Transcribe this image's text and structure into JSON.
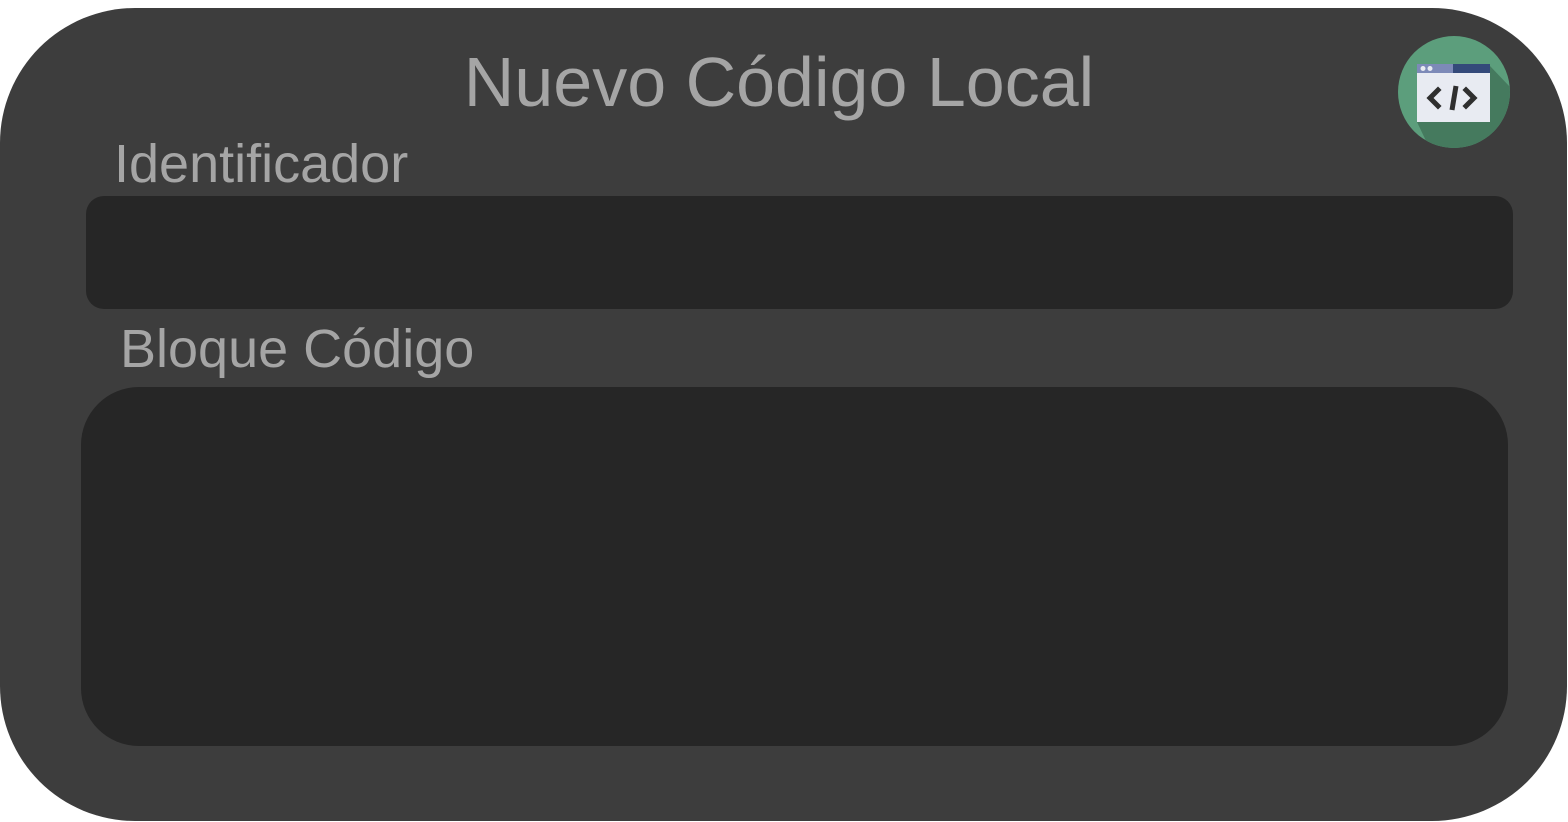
{
  "dialog": {
    "title": "Nuevo Código Local"
  },
  "identifier": {
    "label": "Identificador",
    "value": "",
    "placeholder": ""
  },
  "code_block": {
    "label": "Bloque Código",
    "value": "",
    "placeholder": ""
  },
  "icons": {
    "app_icon": "code-window-icon"
  },
  "colors": {
    "panel_background": "#3d3d3d",
    "field_background": "#262626",
    "text": "#a5a5a5",
    "icon_circle": "#5c9e7c"
  }
}
